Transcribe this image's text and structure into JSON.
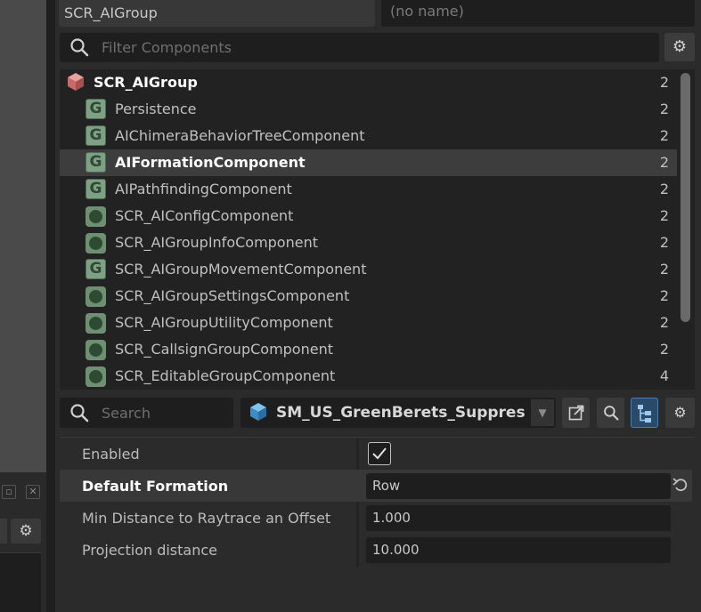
{
  "entity": {
    "name": "SCR_AIGroup",
    "prefab_placeholder": "(no name)"
  },
  "filter": {
    "placeholder": "Filter Components"
  },
  "components": [
    {
      "name": "SCR_AIGroup",
      "count": "2",
      "icon": "cube-icon",
      "bold": true
    },
    {
      "name": "Persistence",
      "count": "2",
      "icon": "g-component-icon"
    },
    {
      "name": "AIChimeraBehaviorTreeComponent",
      "count": "2",
      "icon": "g-component-icon"
    },
    {
      "name": "AIFormationComponent",
      "count": "2",
      "icon": "g-component-icon",
      "selected": true
    },
    {
      "name": "AIPathfindingComponent",
      "count": "2",
      "icon": "g-component-icon"
    },
    {
      "name": "SCR_AIConfigComponent",
      "count": "2",
      "icon": "script-component-icon"
    },
    {
      "name": "SCR_AIGroupInfoComponent",
      "count": "2",
      "icon": "script-component-icon"
    },
    {
      "name": "SCR_AIGroupMovementComponent",
      "count": "2",
      "icon": "g-component-icon"
    },
    {
      "name": "SCR_AIGroupSettingsComponent",
      "count": "2",
      "icon": "script-component-icon"
    },
    {
      "name": "SCR_AIGroupUtilityComponent",
      "count": "2",
      "icon": "script-component-icon"
    },
    {
      "name": "SCR_CallsignGroupComponent",
      "count": "2",
      "icon": "script-component-icon"
    },
    {
      "name": "SCR_EditableGroupComponent",
      "count": "4",
      "icon": "script-component-icon"
    }
  ],
  "search": {
    "placeholder": "Search"
  },
  "prefab": {
    "name": "SM_US_GreenBerets_Suppresso"
  },
  "properties": [
    {
      "label": "Enabled",
      "type": "checkbox",
      "checked": true
    },
    {
      "label": "Default Formation",
      "value": "Row",
      "highlighted": true
    },
    {
      "label": "Min Distance to Raytrace an Offset",
      "value": "1.000"
    },
    {
      "label": "Projection distance",
      "value": "10.000"
    }
  ],
  "colors": {
    "accent": "#4a7ab0",
    "component_icon": "#7fa084",
    "cube": "#c86a6a"
  }
}
